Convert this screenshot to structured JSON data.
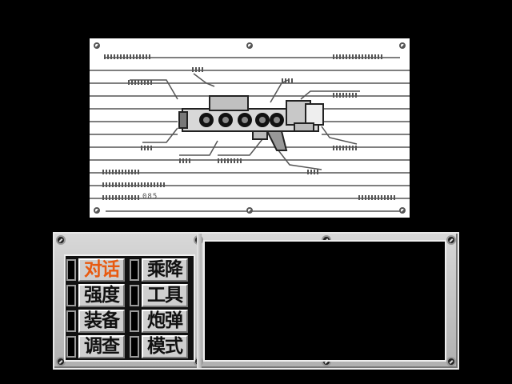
{
  "screen": {
    "background": "#000000"
  },
  "blueprint": {
    "background": "#ffffff",
    "line_color": "#555555",
    "model_code": "085"
  },
  "command_menu": {
    "selected_color": "#e85a10",
    "items": [
      {
        "label": "对话",
        "selected": true
      },
      {
        "label": "乘降",
        "selected": false
      },
      {
        "label": "强度",
        "selected": false
      },
      {
        "label": "工具",
        "selected": false
      },
      {
        "label": "装备",
        "selected": false
      },
      {
        "label": "炮弹",
        "selected": false
      },
      {
        "label": "调查",
        "selected": false
      },
      {
        "label": "模式",
        "selected": false
      }
    ]
  },
  "message_window": {
    "text": ""
  }
}
